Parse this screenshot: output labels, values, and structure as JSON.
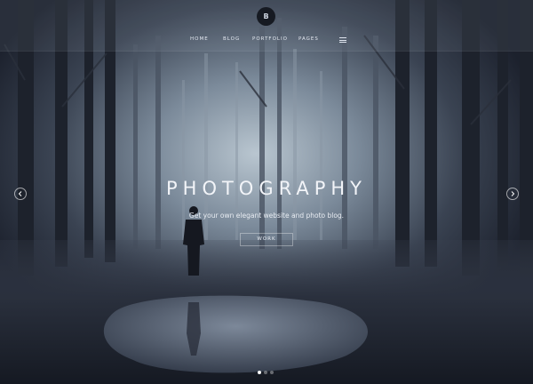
{
  "header": {
    "logo_letter": "B",
    "nav": [
      {
        "label": "HOME"
      },
      {
        "label": "BLOG"
      },
      {
        "label": "PORTFOLIO"
      },
      {
        "label": "PAGES"
      }
    ],
    "menu_icon": "hamburger-icon"
  },
  "hero": {
    "title": "PHOTOGRAPHY",
    "tagline": "Get your own elegant website and photo blog.",
    "button_label": "WORK",
    "prev_icon": "chevron-left-icon",
    "next_icon": "chevron-right-icon"
  },
  "slider": {
    "slide_count": 3,
    "active_index": 0
  },
  "colors": {
    "overlay": "#d2dceb",
    "text": "#f2f4f8"
  }
}
